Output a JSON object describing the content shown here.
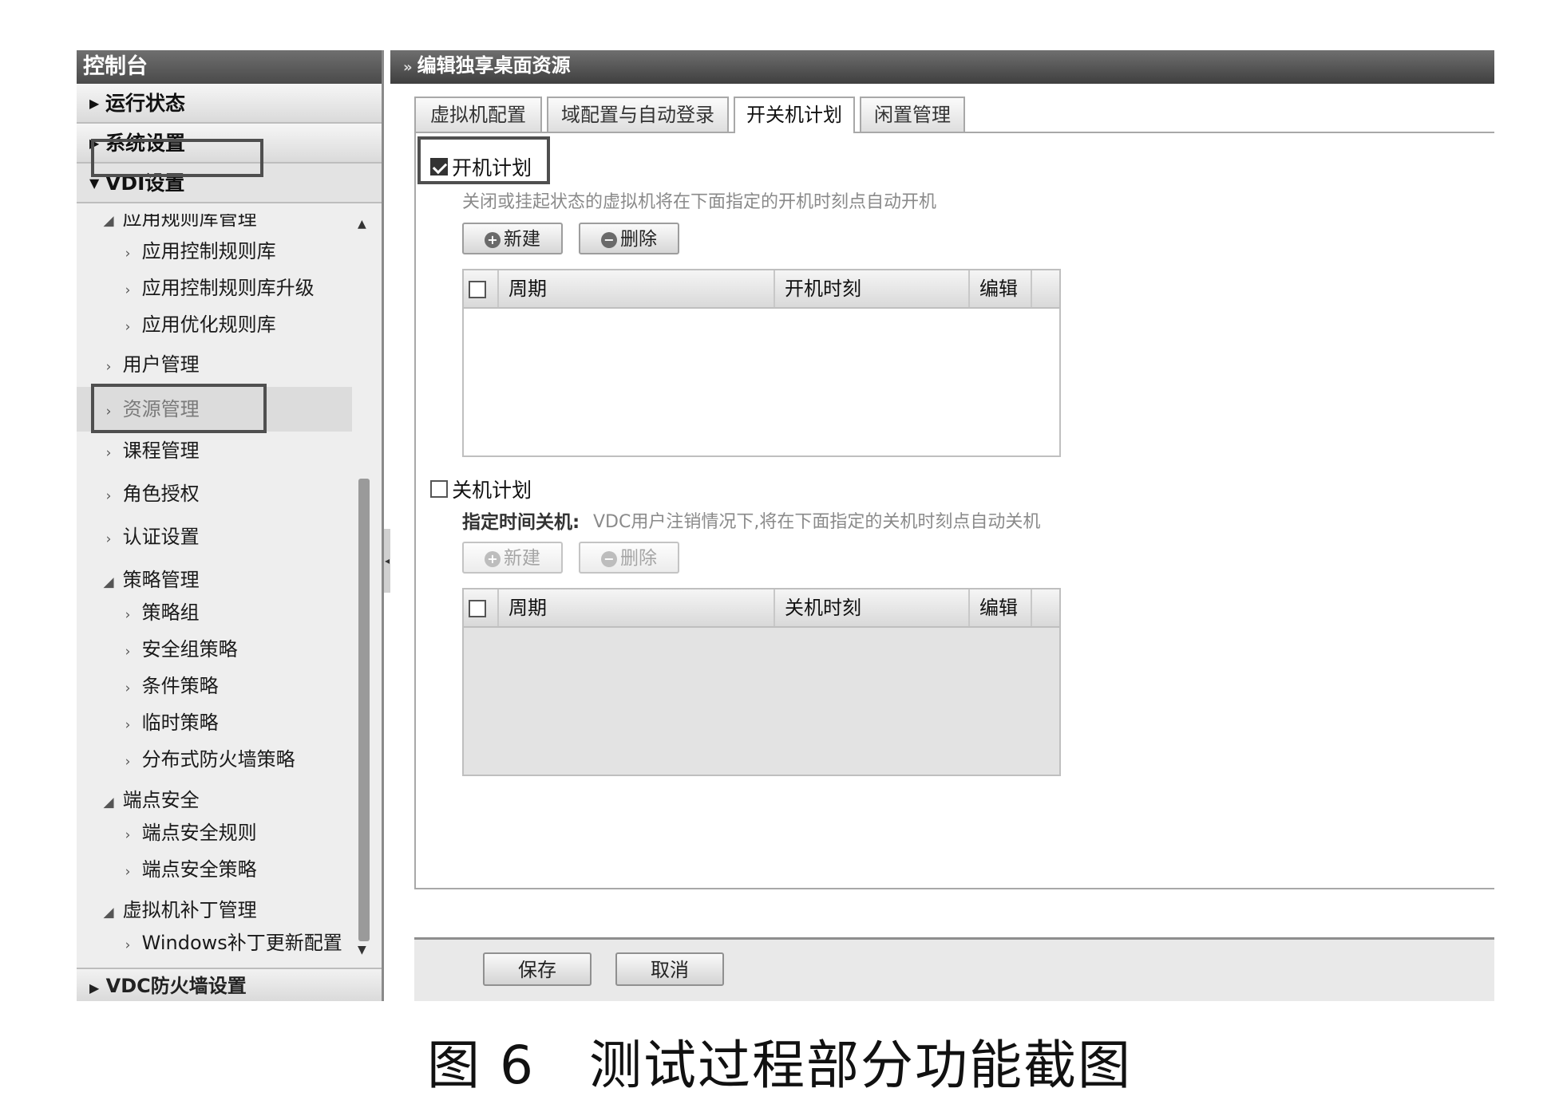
{
  "sidebar": {
    "title": "控制台",
    "top_items": [
      "运行状态",
      "系统设置",
      "VDI设置"
    ],
    "bottom_item": "VDC防火墙设置",
    "tree": [
      {
        "label": "应用规则库管理",
        "level": 1,
        "chevron": "▲"
      },
      {
        "label": "应用控制规则库",
        "level": 2,
        "chevron": "›"
      },
      {
        "label": "应用控制规则库升级",
        "level": 2,
        "chevron": "›"
      },
      {
        "label": "应用优化规则库",
        "level": 2,
        "chevron": "›"
      },
      {
        "label": "用户管理",
        "level": 1,
        "chevron": "›"
      },
      {
        "label": "资源管理",
        "level": 1,
        "chevron": "›",
        "selected": true
      },
      {
        "label": "课程管理",
        "level": 1,
        "chevron": "›"
      },
      {
        "label": "角色授权",
        "level": 1,
        "chevron": "›"
      },
      {
        "label": "认证设置",
        "level": 1,
        "chevron": "›"
      },
      {
        "label": "策略管理",
        "level": 1,
        "chevron": "▲"
      },
      {
        "label": "策略组",
        "level": 2,
        "chevron": "›"
      },
      {
        "label": "安全组策略",
        "level": 2,
        "chevron": "›"
      },
      {
        "label": "条件策略",
        "level": 2,
        "chevron": "›"
      },
      {
        "label": "临时策略",
        "level": 2,
        "chevron": "›"
      },
      {
        "label": "分布式防火墙策略",
        "level": 2,
        "chevron": "›"
      },
      {
        "label": "端点安全",
        "level": 1,
        "chevron": "▲"
      },
      {
        "label": "端点安全规则",
        "level": 2,
        "chevron": "›"
      },
      {
        "label": "端点安全策略",
        "level": 2,
        "chevron": "›"
      },
      {
        "label": "虚拟机补丁管理",
        "level": 1,
        "chevron": "▲"
      },
      {
        "label": "Windows补丁更新配置",
        "level": 2,
        "chevron": "›"
      }
    ]
  },
  "main": {
    "title": "编辑独享桌面资源",
    "tabs": [
      "虚拟机配置",
      "域配置与自动登录",
      "开关机计划",
      "闲置管理"
    ],
    "active_tab": 2,
    "boot": {
      "checkbox_label": "开机计划",
      "checked": true,
      "hint": "关闭或挂起状态的虚拟机将在下面指定的开机时刻点自动开机",
      "new_label": "新建",
      "delete_label": "删除",
      "columns": [
        "周期",
        "开机时刻",
        "编辑"
      ]
    },
    "shutdown": {
      "checkbox_label": "关机计划",
      "checked": false,
      "sub_label": "指定时间关机:",
      "hint": "VDC用户注销情况下,将在下面指定的关机时刻点自动关机",
      "new_label": "新建",
      "delete_label": "删除",
      "columns": [
        "周期",
        "关机时刻",
        "编辑"
      ]
    },
    "footer": {
      "save": "保存",
      "cancel": "取消"
    }
  },
  "caption": "图 6　测试过程部分功能截图",
  "colors": {
    "header_dark": "#4a4a4a",
    "sidebar_bg": "#eeeeee",
    "highlight_box": "#4f4f4f"
  }
}
